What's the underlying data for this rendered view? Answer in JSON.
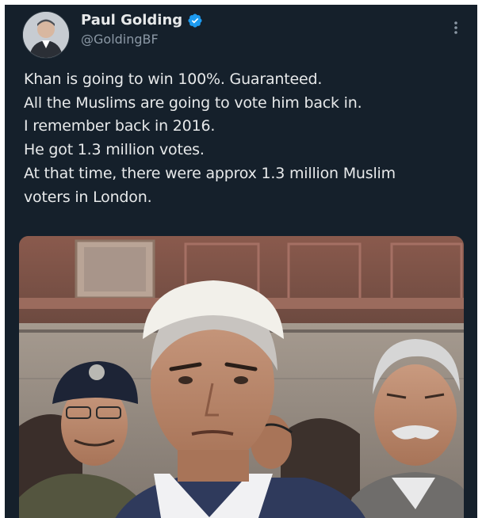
{
  "tweet": {
    "author_name": "Paul Golding",
    "author_handle": "@GoldingBF",
    "lines": [
      "Khan is going to win 100%. Guaranteed.",
      "All the Muslims are going to vote him back in.",
      "I remember back in 2016.",
      "He got 1.3 million votes.",
      "At that time, there were approx 1.3 million Muslim",
      "voters in London."
    ]
  },
  "icons": {
    "verified": "verified-badge-icon",
    "menu": "more-options-icon"
  },
  "colors": {
    "background": "#15202b",
    "text_primary": "#e7e9ea",
    "text_secondary": "#8b98a5",
    "verified_blue": "#1d9bf0"
  }
}
